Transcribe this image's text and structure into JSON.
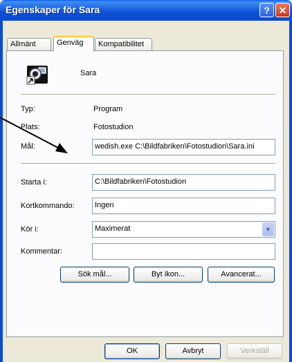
{
  "window": {
    "title": "Egenskaper för Sara",
    "help_label": "?",
    "close_label": "✕"
  },
  "tabs": [
    {
      "label": "Allmänt"
    },
    {
      "label": "Genväg"
    },
    {
      "label": "Kompatibilitet"
    }
  ],
  "header": {
    "name": "Sara",
    "icon": "camera-shortcut-icon"
  },
  "info": {
    "type_label": "Typ:",
    "type_value": "Program",
    "location_label": "Plats:",
    "location_value": "Fotostudion",
    "target_label": "Mål:",
    "target_value": "wedish.exe C:\\Bildfabriken\\Fotostudion\\Sara.ini"
  },
  "fields": {
    "start_in_label": "Starta i:",
    "start_in_value": "C:\\Bildfabriken\\Fotostudion",
    "shortcut_label": "Kortkommando:",
    "shortcut_value": "Ingen",
    "run_label": "Kör i:",
    "run_value": "Maximerat",
    "comment_label": "Kommentar:",
    "comment_value": ""
  },
  "actions": {
    "find_target": "Sök mål...",
    "change_icon": "Byt ikon...",
    "advanced": "Avancerat..."
  },
  "footer": {
    "ok": "OK",
    "cancel": "Avbryt",
    "apply": "Verkställ"
  },
  "colors": {
    "titlebar": "#0b4bd0",
    "tab_highlight": "#ffc83c",
    "field_border": "#7f9db9"
  }
}
